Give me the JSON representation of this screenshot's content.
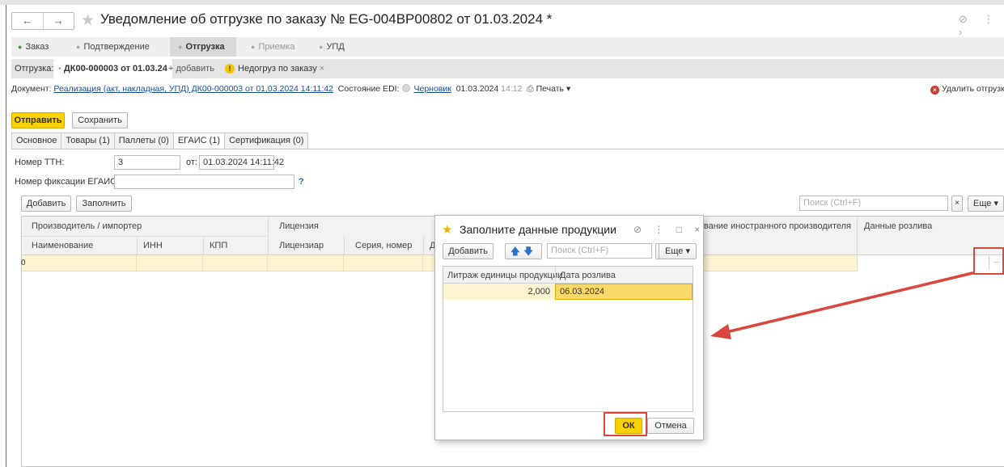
{
  "window": {
    "nav_back": "←",
    "nav_forward": "→",
    "title": "Уведомление об отгрузке по заказу № EG-004BP00802 от 01.03.2024 *",
    "right_icons": "⊘ ⋮ ›"
  },
  "stages": [
    {
      "label": "Заказ",
      "state": "done"
    },
    {
      "label": "Подтверждение",
      "state": "normal"
    },
    {
      "label": "Отгрузка",
      "state": "active"
    },
    {
      "label": "Приемка",
      "state": "muted"
    },
    {
      "label": "УПД",
      "state": "normal"
    }
  ],
  "shipment": {
    "prefix": "Отгрузка:",
    "current": "ДК00-000003 от 01.03.24",
    "add": "+ добавить",
    "warning": "Недогруз по заказу",
    "warning_close": "×"
  },
  "document": {
    "label": "Документ:",
    "link": "Реализация (акт, накладная, УПД) ДК00-000003 от 01.03.2024 14:11:42",
    "edi_label": "Состояние EDI:",
    "edi_state": "Черновик",
    "edi_date": "01.03.2024",
    "edi_time": "14:12",
    "print": "Печать",
    "delete": "Удалить отгрузку"
  },
  "commands": {
    "send": "Отправить",
    "save": "Сохранить"
  },
  "tabs": [
    "Основное",
    "Товары (1)",
    "Паллеты (0)",
    "ЕГАИС (1)",
    "Сертификация (0)"
  ],
  "form": {
    "ttn_label": "Номер ТТН:",
    "ttn_value": "3",
    "from_label": "от:",
    "from_value": "01.03.2024 14:11:42",
    "egais_label": "Номер фиксации ЕГАИС:",
    "egais_value": "",
    "help": "?"
  },
  "table_toolbar": {
    "add": "Добавить",
    "fill": "Заполнить",
    "search_placeholder": "Поиск (Ctrl+F)",
    "clear": "×",
    "more": "Еще"
  },
  "table": {
    "group1": "Производитель / импортер",
    "group2": "Лицензия",
    "col_name": "Наименование",
    "col_inn": "ИНН",
    "col_kpp": "КПП",
    "col_licensee": "Лицензиар",
    "col_series": "Серия, номер",
    "col_d": "Д",
    "col_foreign": "Название иностранного производителя",
    "col_bottling": "Данные розлива",
    "row_number": "0",
    "row_button": "..."
  },
  "dialog": {
    "title": "Заполните данные продукции",
    "ctrl_icons": "⊘ ⋮ □ ×",
    "add": "Добавить",
    "search_placeholder": "Поиск (Ctrl+F)",
    "clear": "×",
    "more": "Еще",
    "col_volume": "Литраж единицы продукции",
    "col_date": "Дата розлива",
    "row_volume": "2,000",
    "row_date": "06.03.2024",
    "ok": "ОК",
    "cancel": "Отмена"
  },
  "colors": {
    "accent_yellow": "#fbd100",
    "annotation_red": "#d9473f",
    "selected_row": "#fcf3d2",
    "link": "#1a4d9c"
  }
}
